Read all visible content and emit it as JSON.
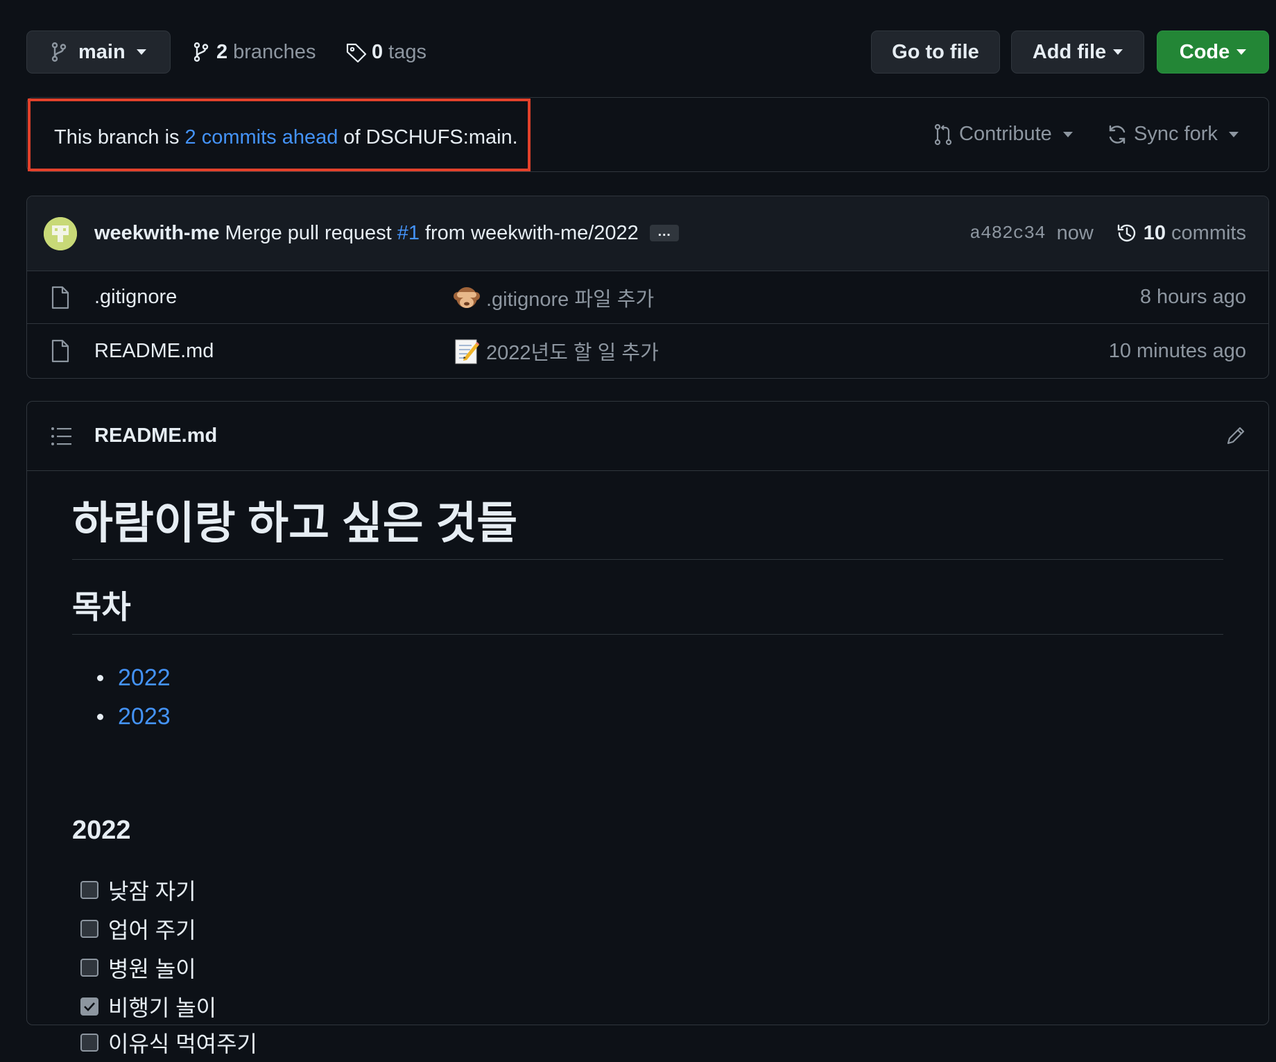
{
  "toolbar": {
    "branch": "main",
    "branches_count": "2",
    "branches_label": "branches",
    "tags_count": "0",
    "tags_label": "tags",
    "go_to_file": "Go to file",
    "add_file": "Add file",
    "code": "Code"
  },
  "banner": {
    "prefix": "This branch is",
    "ahead_link": "2 commits ahead",
    "suffix": "of DSCHUFS:main.",
    "contribute": "Contribute",
    "sync_fork": "Sync fork",
    "highlight_color": "#e2412b"
  },
  "latest_commit": {
    "author": "weekwith-me",
    "message_start": "Merge pull request",
    "pr_link": "#1",
    "message_end": "from weekwith-me/2022",
    "ellipsis": "…",
    "sha": "a482c34",
    "time": "now",
    "commits_count": "10",
    "commits_label": "commits"
  },
  "files": [
    {
      "name": ".gitignore",
      "commit_emoji": "see-no-evil-monkey",
      "commit_message": ".gitignore 파일 추가",
      "age": "8 hours ago"
    },
    {
      "name": "README.md",
      "commit_emoji": "memo",
      "commit_message": "2022년도 할 일 추가",
      "age": "10 minutes ago"
    }
  ],
  "readme": {
    "filename": "README.md",
    "h1": "하람이랑 하고 싶은 것들",
    "toc_heading": "목차",
    "toc": [
      "2022",
      "2023"
    ],
    "section_2022": "2022",
    "tasks": [
      {
        "label": "낮잠 자기",
        "checked": false
      },
      {
        "label": "업어 주기",
        "checked": false
      },
      {
        "label": "병원 놀이",
        "checked": false
      },
      {
        "label": "비행기 놀이",
        "checked": true
      },
      {
        "label": "이유식 먹여주기",
        "checked": false
      }
    ]
  },
  "colors": {
    "background": "#0d1117",
    "border": "#30363d",
    "link": "#4493f8",
    "muted": "#8d96a0",
    "green_button": "#238636"
  }
}
